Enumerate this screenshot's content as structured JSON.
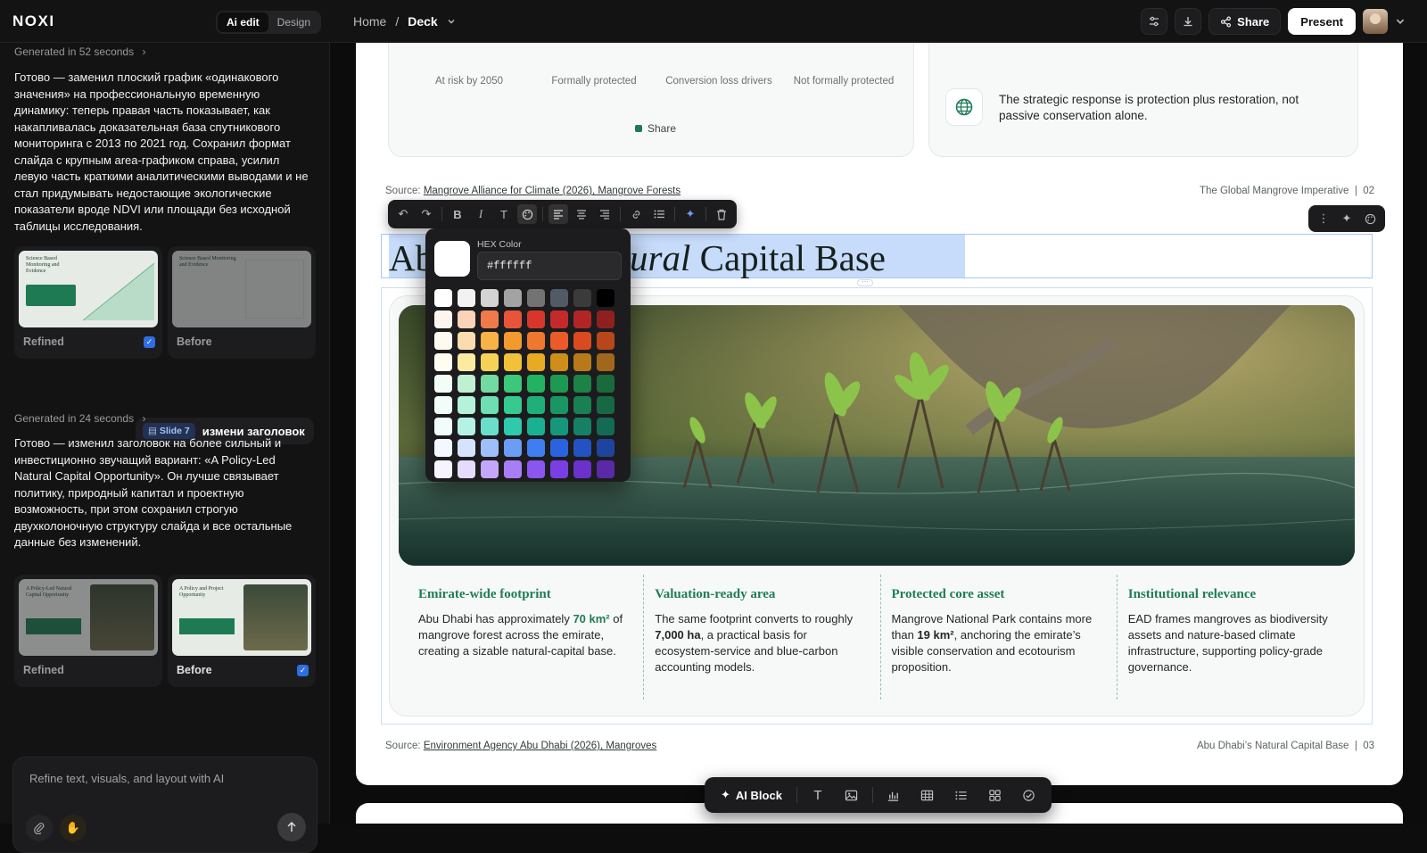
{
  "app": {
    "logo": "NOXI",
    "mode_active": "Ai edit",
    "mode_other": "Design"
  },
  "breadcrumb": {
    "home": "Home",
    "separator": "/",
    "current": "Deck"
  },
  "topbar": {
    "share_label": "Share",
    "present_label": "Present"
  },
  "sidebar": {
    "gen1_time": "Generated in 52 seconds",
    "msg1": "Готово — заменил плоский график «одинакового значения» на профессиональную временную динамику: теперь правая часть показывает, как накапливалась доказательная база спутникового мониторинга с 2013 по 2021 год. Сохранил формат слайда с крупным area-графиком справа, усилил левую часть краткими аналитическими выводами и не стал придумывать недостающие экологические показатели вроде NDVI или площади без исходной таблицы исследования.",
    "thumbs1": [
      {
        "label": "Refined",
        "checked": true,
        "preview_title": "Science Based Monitoring and Evidence"
      },
      {
        "label": "Before",
        "checked": false,
        "preview_title": "Science Based Monitoring and Evidence"
      }
    ],
    "user_msg": {
      "slide_chip": "Slide 7",
      "text": "измени заголовок"
    },
    "gen2_time": "Generated in 24 seconds",
    "msg2": "Готово — изменил заголовок на более сильный и инвестиционно звучащий вариант: «A Policy-Led Natural Capital Opportunity». Он лучше связывает политику, природный капитал и проектную возможность, при этом сохранил строгую двухколоночную структуру слайда и все остальные данные без изменений.",
    "thumbs2": [
      {
        "label": "Refined",
        "checked": false,
        "preview_title": "A Policy-Led Natural Capital Opportunity"
      },
      {
        "label": "Before",
        "checked": true,
        "preview_title": "A Policy and Project Opportunity"
      }
    ],
    "composer_placeholder": "Refine text, visuals, and layout with AI"
  },
  "slide_prev": {
    "stat_labels": [
      "At risk by 2050",
      "Formally protected",
      "Conversion loss drivers",
      "Not formally protected"
    ],
    "legend": "Share",
    "callout": "The strategic response is protection plus restoration, not passive conservation alone.",
    "source_prefix": "Source: ",
    "source_link": "Mangrove Alliance for Climate (2026), Mangrove Forests",
    "page_ref": "The Global Mangrove Imperative  |  02"
  },
  "slide_cur": {
    "title_part1": "Ab",
    "title_italic": "atural",
    "title_part2": " Capital Base",
    "columns": [
      {
        "heading": "Emirate-wide footprint",
        "pre": "Abu Dhabi has approximately ",
        "strong": "70 km²",
        "post": " of mangrove forest across the emirate, creating a sizable natural-capital base."
      },
      {
        "heading": "Valuation-ready area",
        "pre": "The same footprint converts to roughly ",
        "strong": "7,000 ha",
        "post": ", a practical basis for ecosystem-service and blue-carbon accounting models."
      },
      {
        "heading": "Protected core asset",
        "pre": "Mangrove National Park contains more than ",
        "strong": "19 km²",
        "post": ", anchoring the emirate’s visible conservation and ecotourism proposition."
      },
      {
        "heading": "Institutional relevance",
        "pre": "EAD frames mangroves as biodiversity assets and nature-based climate infrastructure, supporting policy-grade governance.",
        "strong": "",
        "post": ""
      }
    ],
    "source_prefix": "Source: ",
    "source_link": "Environment Agency Abu Dhabi (2026), Mangroves",
    "page_ref": "Abu Dhabi’s Natural Capital Base  |  03"
  },
  "color_picker": {
    "label": "HEX Color",
    "value": "#ffffff",
    "swatches": [
      [
        "#ffffff",
        "#f2f2f2",
        "#d4d4d4",
        "#a3a3a3",
        "#737373",
        "#525a66",
        "#3b3b3b",
        "#000000"
      ],
      [
        "#fff5f0",
        "#fcd3b8",
        "#f07b4a",
        "#e8543a",
        "#d9362b",
        "#c52a2a",
        "#b22525",
        "#8f2020"
      ],
      [
        "#fffaf0",
        "#fcdcae",
        "#f7b347",
        "#f29a2e",
        "#f0772e",
        "#eb5b2a",
        "#d94a1f",
        "#b8461b"
      ],
      [
        "#fffdf0",
        "#fbeaa0",
        "#f5d257",
        "#f2c13a",
        "#e8a923",
        "#cf8e1a",
        "#b8791b",
        "#a1681b"
      ],
      [
        "#f2fdf6",
        "#bff0d2",
        "#74dba0",
        "#3cc77a",
        "#22b362",
        "#1c9a52",
        "#1d8248",
        "#196b3c"
      ],
      [
        "#f0fdf8",
        "#b6f1d9",
        "#6ddfb2",
        "#36c990",
        "#1fb079",
        "#199664",
        "#188053",
        "#176946"
      ],
      [
        "#f0fdfb",
        "#b3f2e5",
        "#6adecb",
        "#2fc9ad",
        "#1ab092",
        "#16977c",
        "#158066",
        "#146a55"
      ],
      [
        "#f3f7ff",
        "#d5e3fd",
        "#9ebffa",
        "#6a9df6",
        "#3f7df0",
        "#2a63e0",
        "#2352c3",
        "#1f449e"
      ],
      [
        "#f8f4ff",
        "#e6dbfd",
        "#c4a7fb",
        "#a77ef7",
        "#8b55f0",
        "#7a3ee5",
        "#6a31cc",
        "#5a29a8"
      ]
    ]
  },
  "bottom_toolbar": {
    "ai_block_label": "AI Block"
  }
}
